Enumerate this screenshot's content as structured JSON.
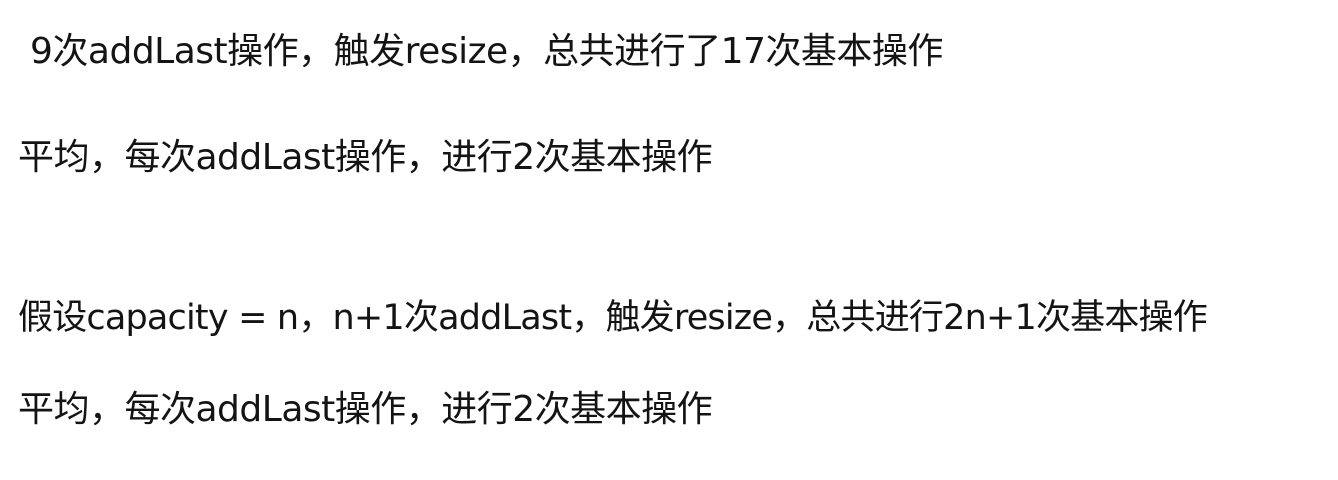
{
  "document": {
    "lines": [
      "9次addLast操作，触发resize，总共进行了17次基本操作",
      "平均，每次addLast操作，进行2次基本操作",
      "假设capacity = n，n+1次addLast，触发resize，总共进行2n+1次基本操作",
      "平均，每次addLast操作，进行2次基本操作"
    ]
  }
}
